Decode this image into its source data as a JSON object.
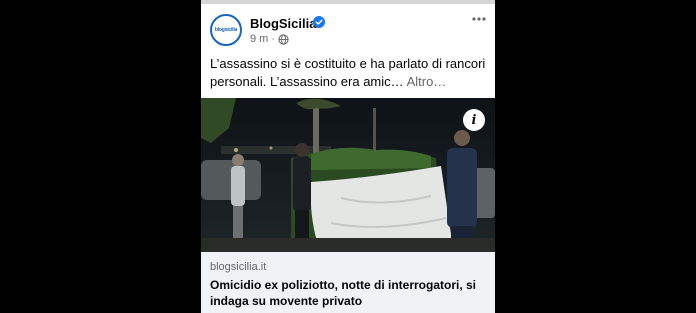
{
  "post": {
    "page_name": "BlogSicilia",
    "avatar_text": "blogsicilia",
    "time": "9 m",
    "privacy_icon": "globe-icon",
    "verified_icon": "verified-badge-icon",
    "more_icon": "more-options-icon",
    "text": "L’assassino si è costituito e ha parlato di rancori personali. L’assassino era amic…",
    "see_more": "Altro…"
  },
  "media": {
    "info_label": "i"
  },
  "link": {
    "domain": "blogsicilia.it",
    "headline": "Omicidio ex poliziotto, notte di interrogatori, si indaga su movente privato"
  },
  "colors": {
    "background": "#000000",
    "card": "#ffffff",
    "link_box": "#f0f2f5",
    "verified": "#1877f2",
    "muted_text": "#65676b"
  }
}
